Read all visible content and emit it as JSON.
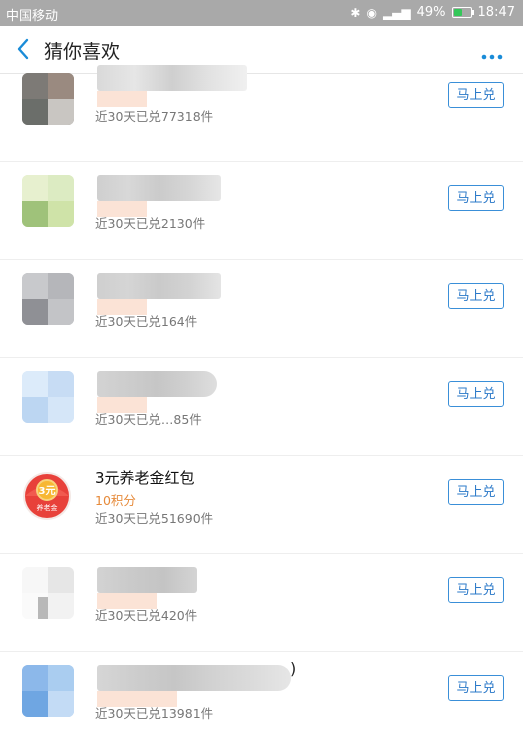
{
  "status_bar": {
    "carrier": "中国移动",
    "battery_percent": "49%",
    "battery_level": 0.49,
    "time": "18:47"
  },
  "nav": {
    "title": "猜你喜欢"
  },
  "colors": {
    "accent": "#1a8cd8",
    "points": "#e68a3a",
    "divider": "#eeeeee"
  },
  "items": [
    {
      "title": "",
      "points": "",
      "sold": "近30天已兑77318件",
      "button": "马上兑"
    },
    {
      "title": "",
      "points": "",
      "sold": "近30天已兑2130件",
      "button": "马上兑"
    },
    {
      "title": "",
      "points": "",
      "sold": "近30天已兑164件",
      "button": "马上兑"
    },
    {
      "title": "",
      "points": "",
      "sold": "近30天已兑…85件",
      "button": "马上兑"
    },
    {
      "title": "3元养老金红包",
      "points": "10积分",
      "sold": "近30天已兑51690件",
      "button": "马上兑",
      "icon_text": "3元",
      "icon_label": "养老金"
    },
    {
      "title": "",
      "points": "",
      "sold": "近30天已兑420件",
      "button": "马上兑"
    },
    {
      "title": ")",
      "points": "",
      "sold": "近30天已兑13981件",
      "button": "马上兑"
    }
  ]
}
